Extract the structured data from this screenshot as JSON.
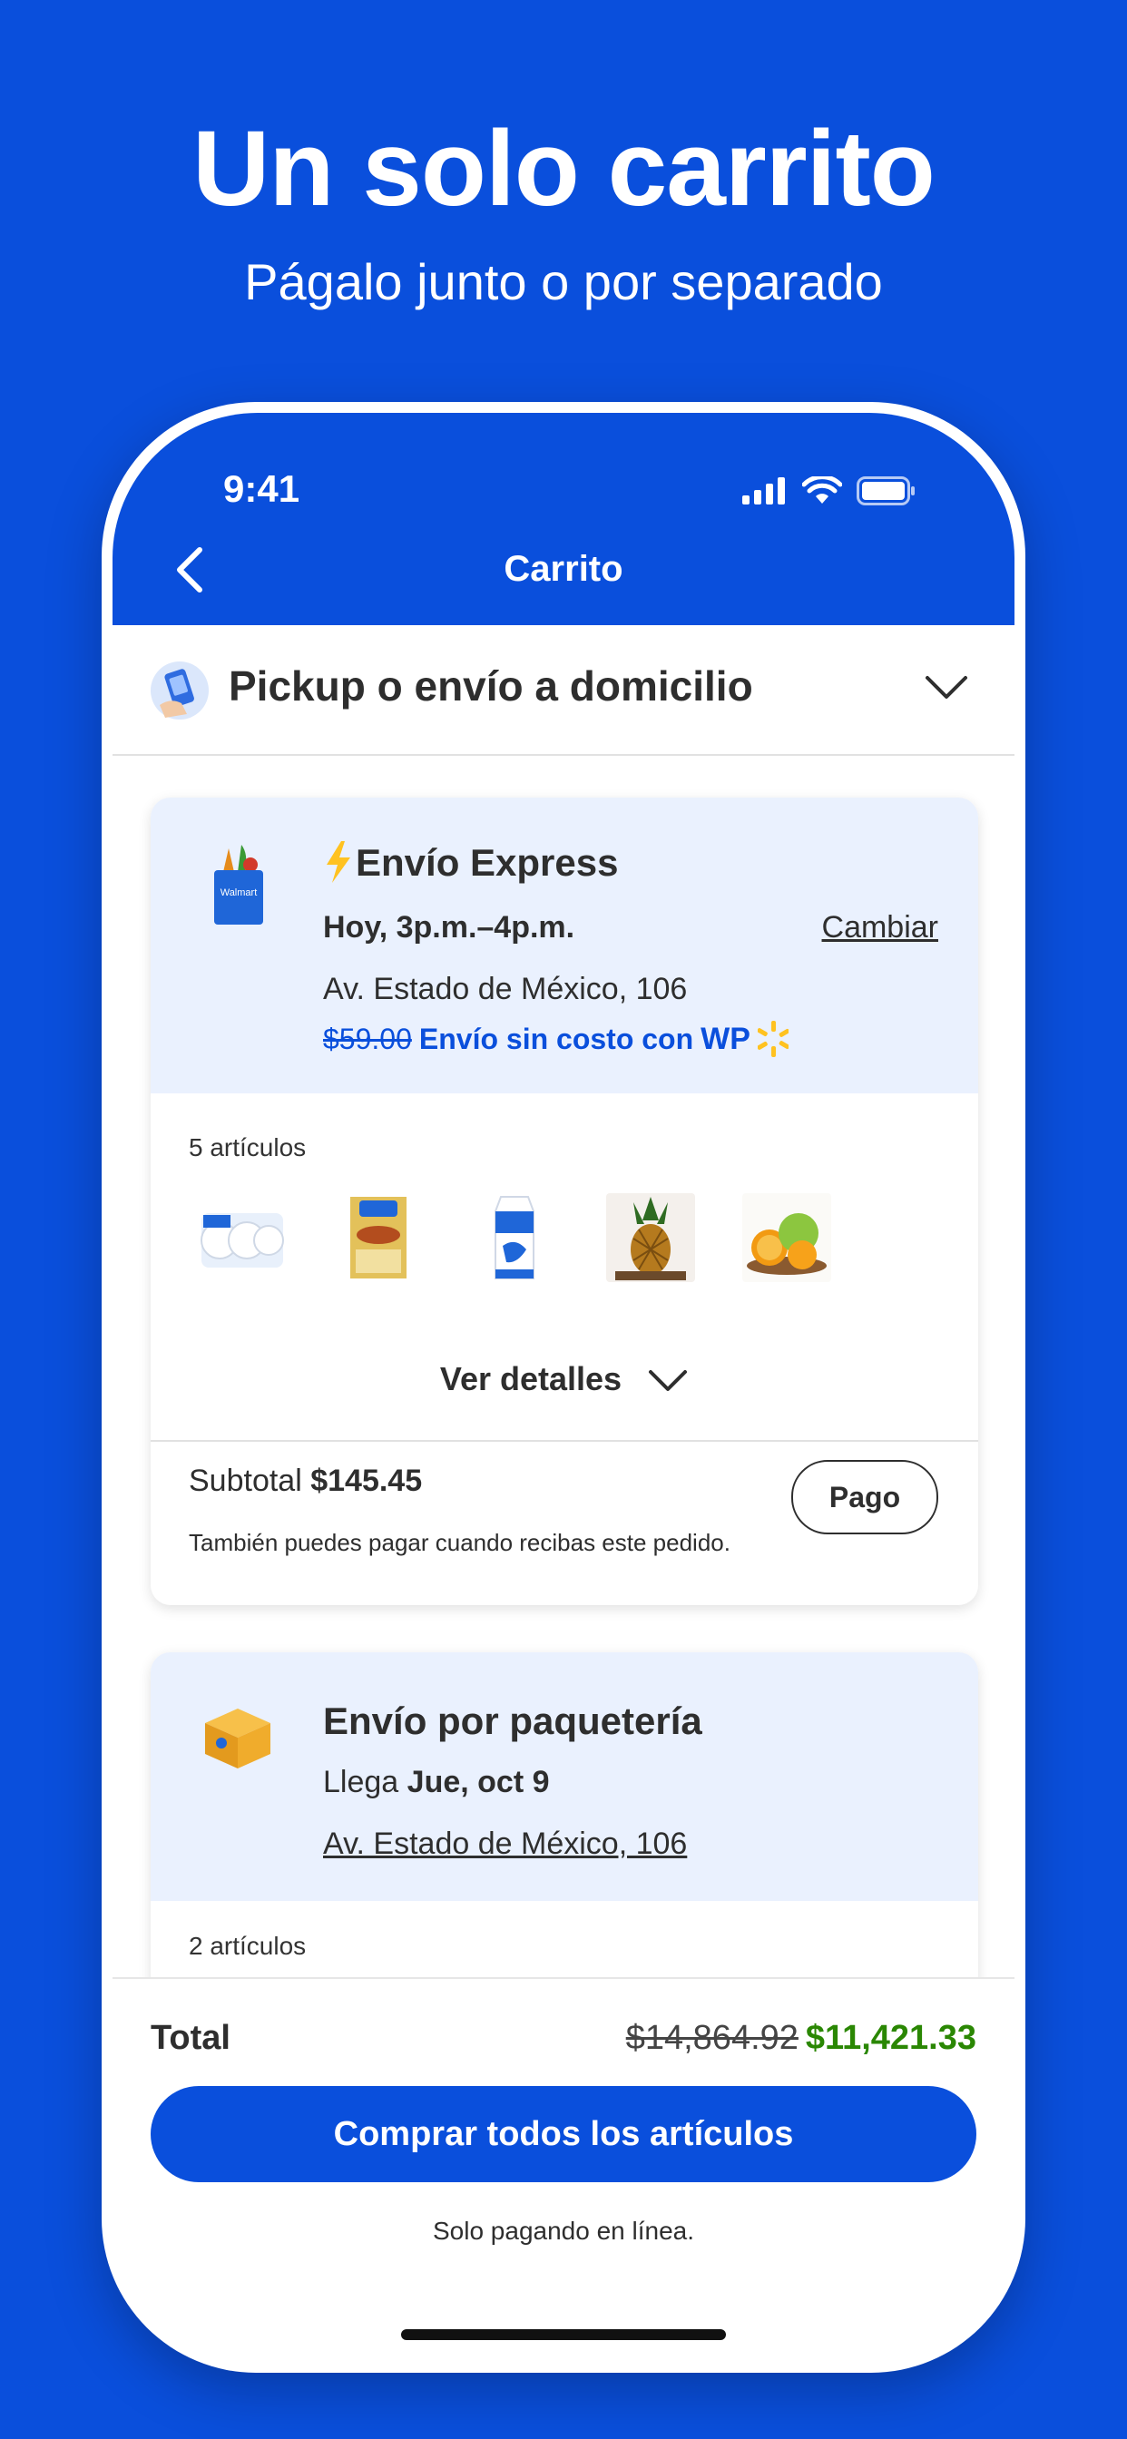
{
  "hero": {
    "title": "Un solo carrito",
    "subtitle": "Págalo junto o por separado"
  },
  "status_bar": {
    "time": "9:41",
    "icons": [
      "signal-icon",
      "wifi-icon",
      "battery-icon"
    ]
  },
  "nav": {
    "title": "Carrito",
    "back_icon": "chevron-left-icon"
  },
  "fulfillment": {
    "label": "Pickup o envío a domicilio",
    "icon": "pickup-phone-icon",
    "chevron": "chevron-down-icon"
  },
  "express_order": {
    "title": "Envío Express",
    "slot": "Hoy, 3p.m.–4p.m.",
    "change_label": "Cambiar",
    "address": "Av. Estado de México, 106",
    "old_fee": "$59.00",
    "free_text": "Envío sin costo con",
    "wp_logo": "WP",
    "item_count": "5 artículos",
    "items": [
      "paper-towels",
      "tostadas",
      "milk",
      "pineapple",
      "oranges"
    ],
    "details_label": "Ver detalles",
    "subtotal_label": "Subtotal",
    "subtotal_value": "$145.45",
    "pay_note": "También puedes pagar cuando recibas este pedido.",
    "pay_button": "Pago"
  },
  "parcel_order": {
    "title": "Envío por paquetería",
    "arrives_prefix": "Llega",
    "arrives_date": "Jue, oct 9",
    "address": "Av. Estado de México, 106",
    "item_count": "2 artículos"
  },
  "checkout": {
    "total_label": "Total",
    "old_total": "$14,864.92",
    "new_total": "$11,421.33",
    "buy_button": "Comprar todos los artículos",
    "online_note": "Solo pagando en línea."
  },
  "colors": {
    "brand_blue": "#0a4fdc",
    "light_blue": "#eaf1fe",
    "savings_green": "#2a8703",
    "spark_yellow": "#ffc220"
  }
}
